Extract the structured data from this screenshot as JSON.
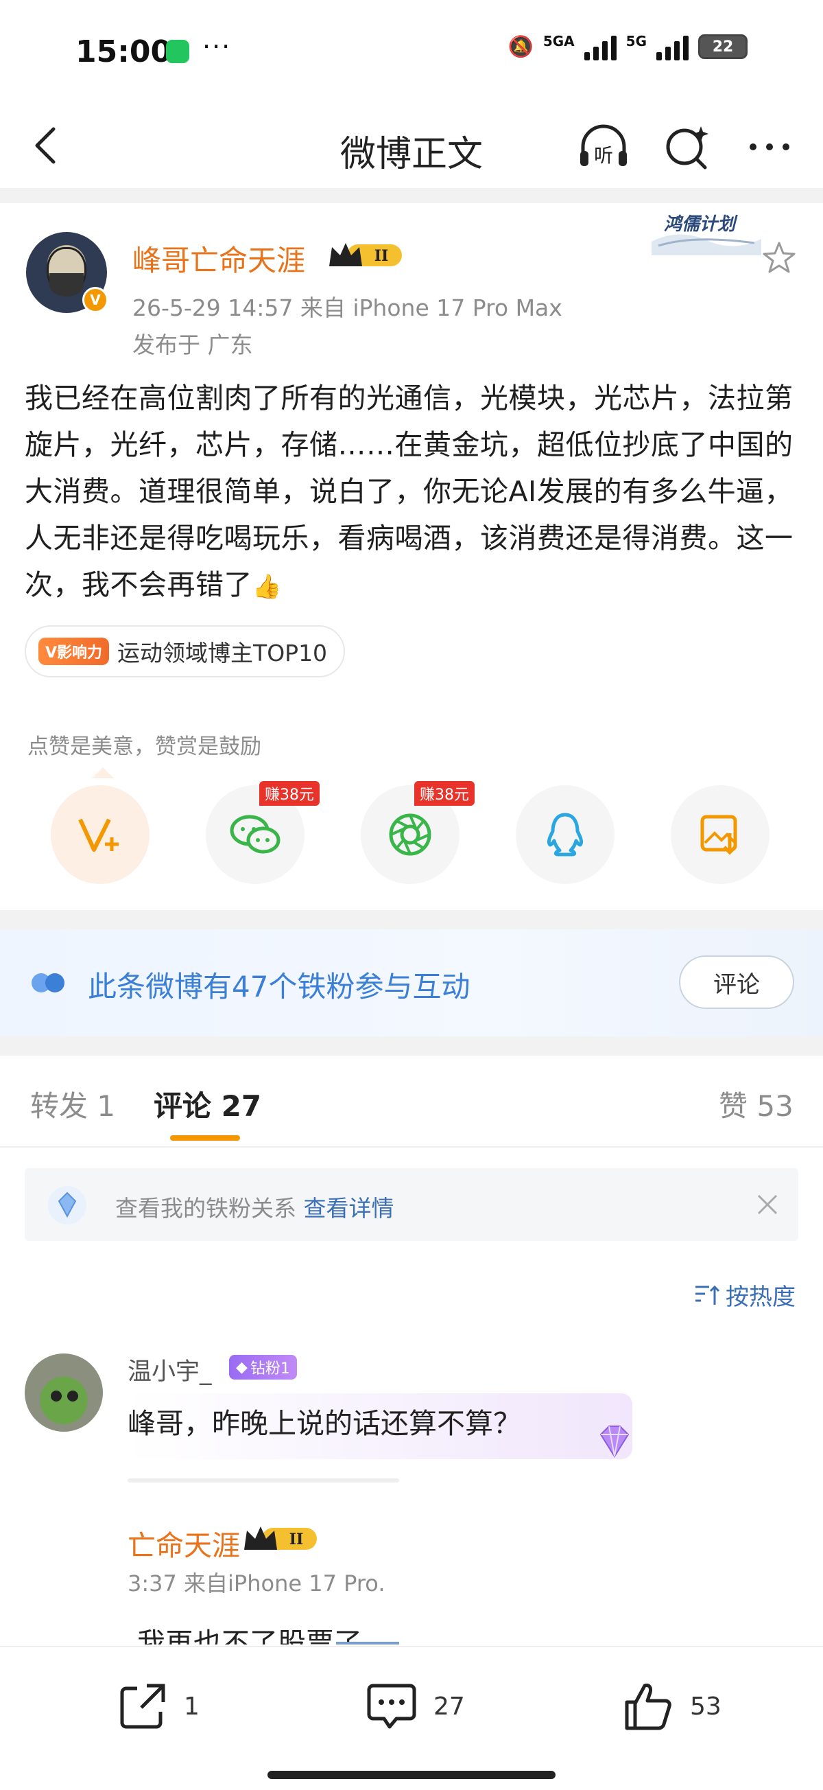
{
  "status_bar": {
    "time": "15:00",
    "dots": "···",
    "net1": "5GA",
    "net2": "5G",
    "battery": "22"
  },
  "nav": {
    "title": "微博正文"
  },
  "post": {
    "username": "峰哥亡命天涯",
    "level_badge": "II",
    "meta": "26-5-29 14:57   来自 iPhone 17 Pro Max",
    "location": "发布于 广东",
    "hongru_tag": "鸿儒计划",
    "text": "我已经在高位割肉了所有的光通信，光模块，光芯片，法拉第旋片，光纤，芯片，存储……在黄金坑，超低位抄底了中国的大消费。道理很简单，说白了，你无论AI发展的有多么牛逼，人无非还是得吃喝玩乐，看病喝酒，该消费还是得消费。这一次，我不会再错了",
    "emoji": "👍",
    "influence_tag": "V影响力",
    "influence_text": "运动领域博主TOP10",
    "reward_hint": "点赞是美意，赞赏是鼓励",
    "share": [
      {
        "name": "vplus",
        "earn": ""
      },
      {
        "name": "wechat",
        "earn": "赚38元"
      },
      {
        "name": "moments",
        "earn": "赚38元"
      },
      {
        "name": "qq",
        "earn": ""
      },
      {
        "name": "save-image",
        "earn": ""
      }
    ]
  },
  "fan_banner": {
    "text": "此条微博有47个铁粉参与互动",
    "button": "评论"
  },
  "tabs": {
    "repost": "转发 1",
    "comment": "评论 27",
    "like": "赞 53"
  },
  "tip": {
    "text": "查看我的铁粉关系 ",
    "link": "查看详情"
  },
  "sort": {
    "label": "按热度"
  },
  "comment": {
    "username": "温小宇_",
    "badge": "钻粉1",
    "text": "峰哥，昨晚上说的话还算不算？"
  },
  "reply": {
    "username": "亡命天涯",
    "level_badge": "II",
    "meta": "3:37  来自iPhone 17 Pro.",
    "text": "我再也不了股票了"
  },
  "bottom_bar": {
    "repost_count": "1",
    "comment_count": "27",
    "like_count": "53"
  },
  "colors": {
    "accent": "#f39800",
    "username": "#e8731a",
    "link": "#3b6fb6",
    "fan_text": "#3b7fd6"
  }
}
